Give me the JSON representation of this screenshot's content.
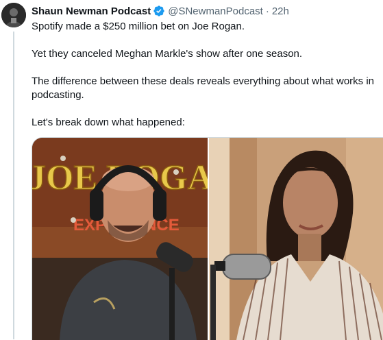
{
  "author": {
    "display_name": "Shaun Newman Podcast",
    "handle": "@SNewmanPodcast",
    "separator": "·",
    "time": "22h"
  },
  "tweet_text": {
    "p1": "Spotify made a $250 million bet on Joe Rogan.",
    "p2": "Yet they canceled Meghan Markle's show after one season.",
    "p3": "The difference between these deals reveals everything about what works in podcasting.",
    "p4": "Let's break down what happened:"
  },
  "media": {
    "left_sign_top": "JOE ROGAN",
    "left_sign_bottom": "EXPERIENCE"
  },
  "colors": {
    "verified": "#1d9bf0",
    "secondary_text": "#536471",
    "thread_line": "#cfd9de",
    "sign_yellow": "#e8c84a",
    "sign_red": "#c0392b"
  },
  "icons": {
    "verified": "verified-badge-icon",
    "avatar": "avatar"
  }
}
